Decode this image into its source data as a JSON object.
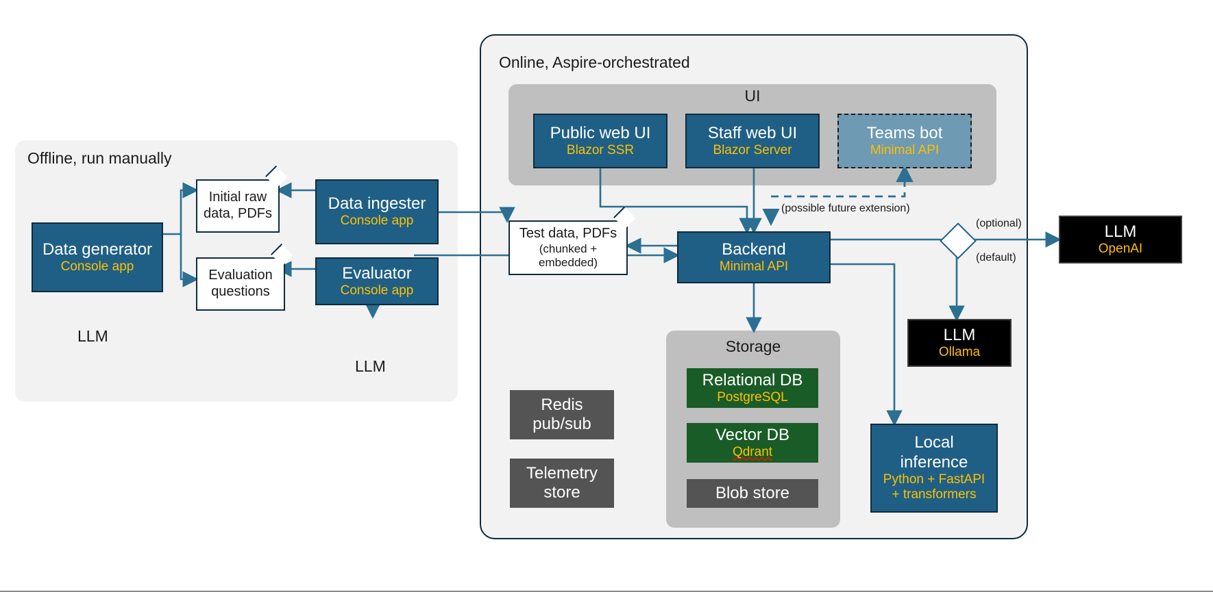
{
  "offline": {
    "panel_title": "Offline, run manually",
    "nodes": {
      "data_generator": {
        "title": "Data generator",
        "subtitle": "Console app"
      },
      "initial_raw": {
        "title": "Initial raw data, PDFs"
      },
      "data_ingester": {
        "title": "Data ingester",
        "subtitle": "Console app"
      },
      "evaluation_questions": {
        "title": "Evaluation questions"
      },
      "evaluator": {
        "title": "Evaluator",
        "subtitle": "Console app"
      },
      "llm_from_generator": {
        "label": "LLM"
      },
      "llm_from_evaluator": {
        "label": "LLM"
      }
    }
  },
  "online": {
    "panel_title": "Online, Aspire-orchestrated",
    "ui_group": {
      "label": "UI",
      "items": [
        {
          "title": "Public web UI",
          "subtitle": "Blazor SSR"
        },
        {
          "title": "Staff web UI",
          "subtitle": "Blazor Server"
        },
        {
          "title": "Teams bot",
          "subtitle": "Minimal API"
        }
      ]
    },
    "future_note": "(possible future extension)",
    "test_data": {
      "title": "Test data, PDFs",
      "subtitle_line1": "(chunked +",
      "subtitle_line2": "embedded)"
    },
    "backend": {
      "title": "Backend",
      "subtitle": "Minimal API"
    },
    "storage_group": {
      "label": "Storage",
      "items": [
        {
          "title": "Relational DB",
          "subtitle": "PostgreSQL",
          "spellcheck": false
        },
        {
          "title": "Vector DB",
          "subtitle": "Qdrant",
          "spellcheck": true
        },
        {
          "title": "Blob store",
          "subtitle": ""
        }
      ]
    },
    "infra": [
      {
        "title_line1": "Redis",
        "title_line2": "pub/sub"
      },
      {
        "title_line1": "Telemetry",
        "title_line2": "store"
      }
    ],
    "llm_ollama": {
      "title": "LLM",
      "subtitle": "Ollama"
    },
    "local_inference": {
      "title_line1": "Local",
      "title_line2": "inference",
      "subtitle_line1": "Python + FastAPI",
      "subtitle_line2": "+ transformers"
    },
    "decision": {
      "optional_label": "(optional)",
      "default_label": "(default)"
    }
  },
  "external": {
    "llm_openai": {
      "title": "LLM",
      "subtitle": "OpenAI"
    }
  },
  "colors": {
    "blue": "#1f5f85",
    "blue_light": "#6e9ab3",
    "green": "#1a5c27",
    "grey_box": "#545454",
    "group_grey": "#bfbfbf",
    "panel_grey": "#f2f2f2",
    "accent_yellow": "#ffc000",
    "black": "#000000",
    "wire": "#2b6f93"
  }
}
